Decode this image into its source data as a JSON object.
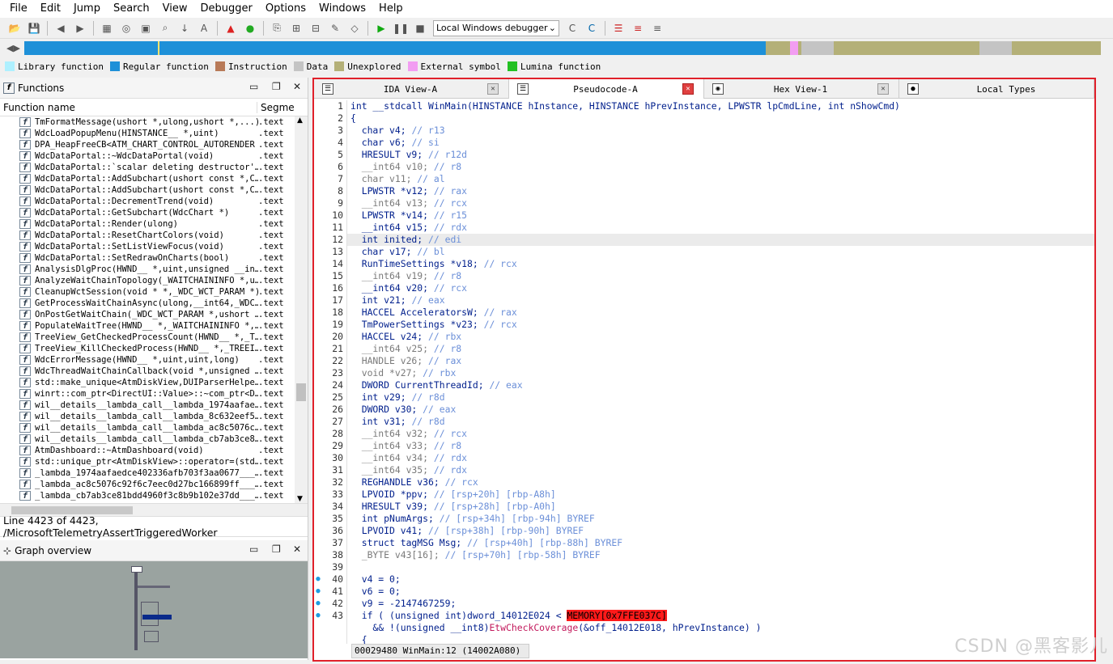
{
  "menu": [
    "File",
    "Edit",
    "Jump",
    "Search",
    "View",
    "Debugger",
    "Options",
    "Windows",
    "Help"
  ],
  "toolbar": {
    "debugger_select": "Local Windows debugger"
  },
  "legend": [
    {
      "label": "Library function",
      "color": "#aef0ff"
    },
    {
      "label": "Regular function",
      "color": "#1e90d8"
    },
    {
      "label": "Instruction",
      "color": "#b87a58"
    },
    {
      "label": "Data",
      "color": "#c4c4c4"
    },
    {
      "label": "Unexplored",
      "color": "#b4b078"
    },
    {
      "label": "External symbol",
      "color": "#f29df2"
    },
    {
      "label": "Lumina function",
      "color": "#22c022"
    }
  ],
  "functions_pane": {
    "title": "Functions",
    "col_name": "Function name",
    "col_segment": "Segme",
    "rows": [
      {
        "name": "TmFormatMessage(ushort *,ulong,ushort *,...)",
        "seg": ".text"
      },
      {
        "name": "WdcLoadPopupMenu(HINSTANCE__ *,uint)",
        "seg": ".text"
      },
      {
        "name": "DPA_HeapFreeCB<ATM_CHART_CONTROL_AUTORENDER",
        "seg": ".text"
      },
      {
        "name": "WdcDataPortal::~WdcDataPortal(void)",
        "seg": ".text"
      },
      {
        "name": "WdcDataPortal::`scalar deleting destructor'…",
        "seg": ".text"
      },
      {
        "name": "WdcDataPortal::AddSubchart(ushort const *,C…",
        "seg": ".text"
      },
      {
        "name": "WdcDataPortal::AddSubchart(ushort const *,C…",
        "seg": ".text"
      },
      {
        "name": "WdcDataPortal::DecrementTrend(void)",
        "seg": ".text"
      },
      {
        "name": "WdcDataPortal::GetSubchart(WdcChart *)",
        "seg": ".text"
      },
      {
        "name": "WdcDataPortal::Render(ulong)",
        "seg": ".text"
      },
      {
        "name": "WdcDataPortal::ResetChartColors(void)",
        "seg": ".text"
      },
      {
        "name": "WdcDataPortal::SetListViewFocus(void)",
        "seg": ".text"
      },
      {
        "name": "WdcDataPortal::SetRedrawOnCharts(bool)",
        "seg": ".text"
      },
      {
        "name": "AnalysisDlgProc(HWND__ *,uint,unsigned __in…",
        "seg": ".text"
      },
      {
        "name": "AnalyzeWaitChainTopology(_WAITCHAININFO *,u…",
        "seg": ".text"
      },
      {
        "name": "CleanupWctSession(void * *,_WDC_WCT_PARAM *)",
        "seg": ".text"
      },
      {
        "name": "GetProcessWaitChainAsync(ulong,__int64,_WDC…",
        "seg": ".text"
      },
      {
        "name": "OnPostGetWaitChain(_WDC_WCT_PARAM *,ushort …",
        "seg": ".text"
      },
      {
        "name": "PopulateWaitTree(HWND__ *,_WAITCHAININFO *,…",
        "seg": ".text"
      },
      {
        "name": "TreeView_GetCheckedProcessCount(HWND__ *,_T…",
        "seg": ".text"
      },
      {
        "name": "TreeView_KillCheckedProcess(HWND__ *,_TREEI…",
        "seg": ".text"
      },
      {
        "name": "WdcErrorMessage(HWND__ *,uint,uint,long)",
        "seg": ".text"
      },
      {
        "name": "WdcThreadWaitChainCallback(void *,unsigned …",
        "seg": ".text"
      },
      {
        "name": "std::make_unique<AtmDiskView,DUIParserHelpe…",
        "seg": ".text"
      },
      {
        "name": "winrt::com_ptr<DirectUI::Value>::~com_ptr<D…",
        "seg": ".text"
      },
      {
        "name": "wil__details__lambda_call__lambda_1974aafae…",
        "seg": ".text"
      },
      {
        "name": "wil__details__lambda_call__lambda_8c632eef5…",
        "seg": ".text"
      },
      {
        "name": "wil__details__lambda_call__lambda_ac8c5076c…",
        "seg": ".text"
      },
      {
        "name": "wil__details__lambda_call__lambda_cb7ab3ce8…",
        "seg": ".text"
      },
      {
        "name": "AtmDashboard::~AtmDashboard(void)",
        "seg": ".text"
      },
      {
        "name": "std::unique_ptr<AtmDiskView>::operator=(std…",
        "seg": ".text"
      },
      {
        "name": "_lambda_1974aafaedce402336afb703f3aa0677___…",
        "seg": ".text"
      },
      {
        "name": "_lambda_ac8c5076c92f6c7eec0d27bc166899ff___…",
        "seg": ".text"
      },
      {
        "name": "_lambda_cb7ab3ce81bdd4960f3c8b9b102e37dd___…",
        "seg": ".text"
      }
    ],
    "status": "Line 4423 of 4423, /MicrosoftTelemetryAssertTriggeredWorker"
  },
  "graph_pane": {
    "title": "Graph overview"
  },
  "tabs": [
    {
      "label": "IDA View-A",
      "icon": "☰"
    },
    {
      "label": "Pseudocode-A",
      "icon": "☰",
      "active": true
    },
    {
      "label": "Hex View-1",
      "icon": "◉"
    },
    {
      "label": "Local Types",
      "icon": "●"
    }
  ],
  "code": [
    {
      "n": "1",
      "t": "int __stdcall WinMain(HINSTANCE hInstance, HINSTANCE hPrevInstance, LPWSTR lpCmdLine, int nShowCmd)",
      "c": "",
      "g": false
    },
    {
      "n": "2",
      "t": "{",
      "c": "",
      "g": false
    },
    {
      "n": "3",
      "t": "  char v4; ",
      "c": "// r13",
      "g": false
    },
    {
      "n": "4",
      "t": "  char v6; ",
      "c": "// si",
      "g": false
    },
    {
      "n": "5",
      "t": "  HRESULT v9; ",
      "c": "// r12d",
      "g": false
    },
    {
      "n": "6",
      "t": "  __int64 v10; ",
      "c": "// r8",
      "g": true
    },
    {
      "n": "7",
      "t": "  char v11; ",
      "c": "// al",
      "g": true
    },
    {
      "n": "8",
      "t": "  LPWSTR *v12; ",
      "c": "// rax",
      "g": false
    },
    {
      "n": "9",
      "t": "  __int64 v13; ",
      "c": "// rcx",
      "g": true
    },
    {
      "n": "10",
      "t": "  LPWSTR *v14; ",
      "c": "// r15",
      "g": false
    },
    {
      "n": "11",
      "t": "  __int64 v15; ",
      "c": "// rdx",
      "g": false
    },
    {
      "n": "12",
      "t": "  int inited; ",
      "c": "// edi",
      "g": false,
      "hl": true
    },
    {
      "n": "13",
      "t": "  char v17; ",
      "c": "// bl",
      "g": false
    },
    {
      "n": "14",
      "t": "  RunTimeSettings *v18; ",
      "c": "// rcx",
      "g": false
    },
    {
      "n": "15",
      "t": "  __int64 v19; ",
      "c": "// r8",
      "g": true
    },
    {
      "n": "16",
      "t": "  __int64 v20; ",
      "c": "// rcx",
      "g": false
    },
    {
      "n": "17",
      "t": "  int v21; ",
      "c": "// eax",
      "g": false
    },
    {
      "n": "18",
      "t": "  HACCEL AcceleratorsW; ",
      "c": "// rax",
      "g": false
    },
    {
      "n": "19",
      "t": "  TmPowerSettings *v23; ",
      "c": "// rcx",
      "g": false
    },
    {
      "n": "20",
      "t": "  HACCEL v24; ",
      "c": "// rbx",
      "g": false
    },
    {
      "n": "21",
      "t": "  __int64 v25; ",
      "c": "// r8",
      "g": true
    },
    {
      "n": "22",
      "t": "  HANDLE v26; ",
      "c": "// rax",
      "g": true
    },
    {
      "n": "23",
      "t": "  void *v27; ",
      "c": "// rbx",
      "g": true
    },
    {
      "n": "24",
      "t": "  DWORD CurrentThreadId; ",
      "c": "// eax",
      "g": false
    },
    {
      "n": "25",
      "t": "  int v29; ",
      "c": "// r8d",
      "g": false
    },
    {
      "n": "26",
      "t": "  DWORD v30; ",
      "c": "// eax",
      "g": false
    },
    {
      "n": "27",
      "t": "  int v31; ",
      "c": "// r8d",
      "g": false
    },
    {
      "n": "28",
      "t": "  __int64 v32; ",
      "c": "// rcx",
      "g": true
    },
    {
      "n": "29",
      "t": "  __int64 v33; ",
      "c": "// r8",
      "g": true
    },
    {
      "n": "30",
      "t": "  __int64 v34; ",
      "c": "// rdx",
      "g": true
    },
    {
      "n": "31",
      "t": "  __int64 v35; ",
      "c": "// rdx",
      "g": true
    },
    {
      "n": "32",
      "t": "  REGHANDLE v36; ",
      "c": "// rcx",
      "g": false
    },
    {
      "n": "33",
      "t": "  LPVOID *ppv; ",
      "c": "// [rsp+20h] [rbp-A8h]",
      "g": false
    },
    {
      "n": "34",
      "t": "  HRESULT v39; ",
      "c": "// [rsp+28h] [rbp-A0h]",
      "g": false
    },
    {
      "n": "35",
      "t": "  int pNumArgs; ",
      "c": "// [rsp+34h] [rbp-94h] BYREF",
      "g": false
    },
    {
      "n": "36",
      "t": "  LPVOID v41; ",
      "c": "// [rsp+38h] [rbp-90h] BYREF",
      "g": false
    },
    {
      "n": "37",
      "t": "  struct tagMSG Msg; ",
      "c": "// [rsp+40h] [rbp-88h] BYREF",
      "g": false
    },
    {
      "n": "38",
      "t": "  _BYTE v43[16]; ",
      "c": "// [rsp+70h] [rbp-58h] BYREF",
      "g": true
    },
    {
      "n": "39",
      "t": "",
      "c": "",
      "g": false
    },
    {
      "n": "40",
      "t": "  v4 = 0;",
      "c": "",
      "g": false,
      "dot": true
    },
    {
      "n": "41",
      "t": "  v6 = 0;",
      "c": "",
      "g": false,
      "dot": true
    },
    {
      "n": "42",
      "t": "  v9 = -2147467259;",
      "c": "",
      "g": false,
      "dot": true
    },
    {
      "n": "43",
      "t": "  if ( (unsigned int)dword_14012E024 < ",
      "c": "",
      "g": false,
      "dot": true,
      "red": "MEMORY[0x7FFE037C]"
    },
    {
      "n": "",
      "t": "    && !(unsigned __int8)",
      "c": "",
      "g": false,
      "fn": "EtwCheckCoverage",
      "after": "(&off_14012E018, hPrevInstance) )"
    },
    {
      "n": "",
      "t": "  {",
      "c": "",
      "g": false
    }
  ],
  "code_status": "00029480 WinMain:12 (14002A080)",
  "watermark": "CSDN @黑客影儿"
}
